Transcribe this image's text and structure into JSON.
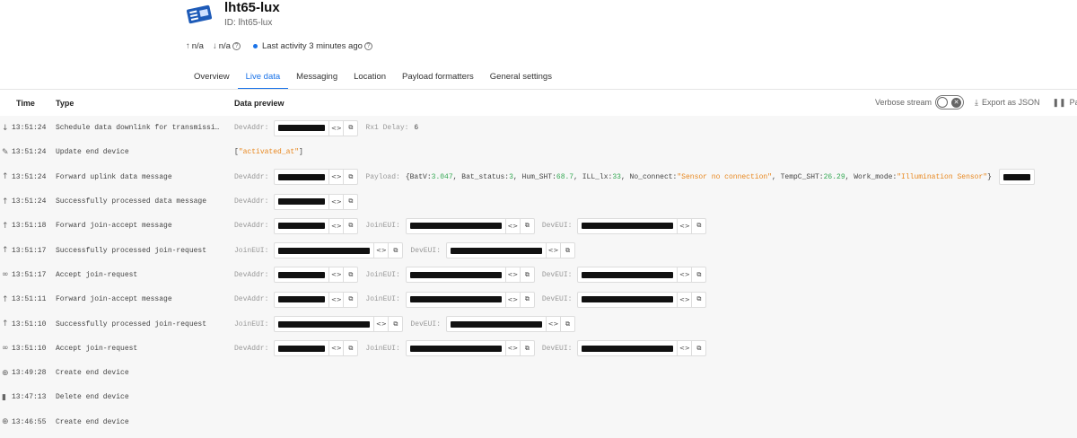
{
  "device": {
    "title": "lht65-lux",
    "id_text": "ID: lht65-lux",
    "up_value": "n/a",
    "down_value": "n/a",
    "activity": "Last activity 3 minutes ago"
  },
  "tabs": [
    "Overview",
    "Live data",
    "Messaging",
    "Location",
    "Payload formatters",
    "General settings"
  ],
  "active_tab": "Live data",
  "table": {
    "col_time": "Time",
    "col_type": "Type",
    "col_preview": "Data preview",
    "verbose_label": "Verbose stream",
    "export_label": "Export as JSON",
    "pause_label": "Par"
  },
  "rows": [
    {
      "icon": "arrow-down-icon",
      "time": "13:51:24",
      "type": "Schedule data downlink for transmissi…",
      "kind": "downlink",
      "rx1_label": "Rx1 Delay:",
      "rx1_value": "6"
    },
    {
      "icon": "pencil-icon",
      "time": "13:51:24",
      "type": "Update end device",
      "kind": "update",
      "value": "\"activated_at\""
    },
    {
      "icon": "arrow-up-icon",
      "time": "13:51:24",
      "type": "Forward uplink data message",
      "kind": "uplink",
      "payload_label": "Payload:",
      "payload": [
        {
          "k": "BatV",
          "v": "3.047",
          "t": "num"
        },
        {
          "k": "Bat_status",
          "v": "3",
          "t": "num"
        },
        {
          "k": "Hum_SHT",
          "v": "68.7",
          "t": "num"
        },
        {
          "k": "ILL_lx",
          "v": "33",
          "t": "num"
        },
        {
          "k": "No_connect",
          "v": "\"Sensor no connection\"",
          "t": "str"
        },
        {
          "k": "TempC_SHT",
          "v": "26.29",
          "t": "num"
        },
        {
          "k": "Work_mode",
          "v": "\"Illumination Sensor\"",
          "t": "str"
        }
      ]
    },
    {
      "icon": "arrow-up-icon",
      "time": "13:51:24",
      "type": "Successfully processed data message",
      "kind": "addr"
    },
    {
      "icon": "arrow-up-icon",
      "time": "13:51:18",
      "type": "Forward join-accept message",
      "kind": "addr-join-dev"
    },
    {
      "icon": "arrow-up-icon",
      "time": "13:51:17",
      "type": "Successfully processed join-request",
      "kind": "join-dev"
    },
    {
      "icon": "link-icon",
      "time": "13:51:17",
      "type": "Accept join-request",
      "kind": "addr-join-dev"
    },
    {
      "icon": "arrow-up-icon",
      "time": "13:51:11",
      "type": "Forward join-accept message",
      "kind": "addr-join-dev"
    },
    {
      "icon": "arrow-up-icon",
      "time": "13:51:10",
      "type": "Successfully processed join-request",
      "kind": "join-dev"
    },
    {
      "icon": "link-icon",
      "time": "13:51:10",
      "type": "Accept join-request",
      "kind": "addr-join-dev"
    },
    {
      "icon": "plus-circle-icon",
      "time": "13:49:28",
      "type": "Create end device",
      "kind": "none"
    },
    {
      "icon": "trash-icon",
      "time": "13:47:13",
      "type": "Delete end device",
      "kind": "none"
    },
    {
      "icon": "plus-circle-icon",
      "time": "13:46:55",
      "type": "Create end device",
      "kind": "none"
    }
  ],
  "labels": {
    "devaddr": "DevAddr:",
    "joineui": "JoinEUI:",
    "deveui": "DevEUI:"
  },
  "colors": {
    "accent": "#1a73e8",
    "string": "#e8871e",
    "number": "#34a853"
  }
}
